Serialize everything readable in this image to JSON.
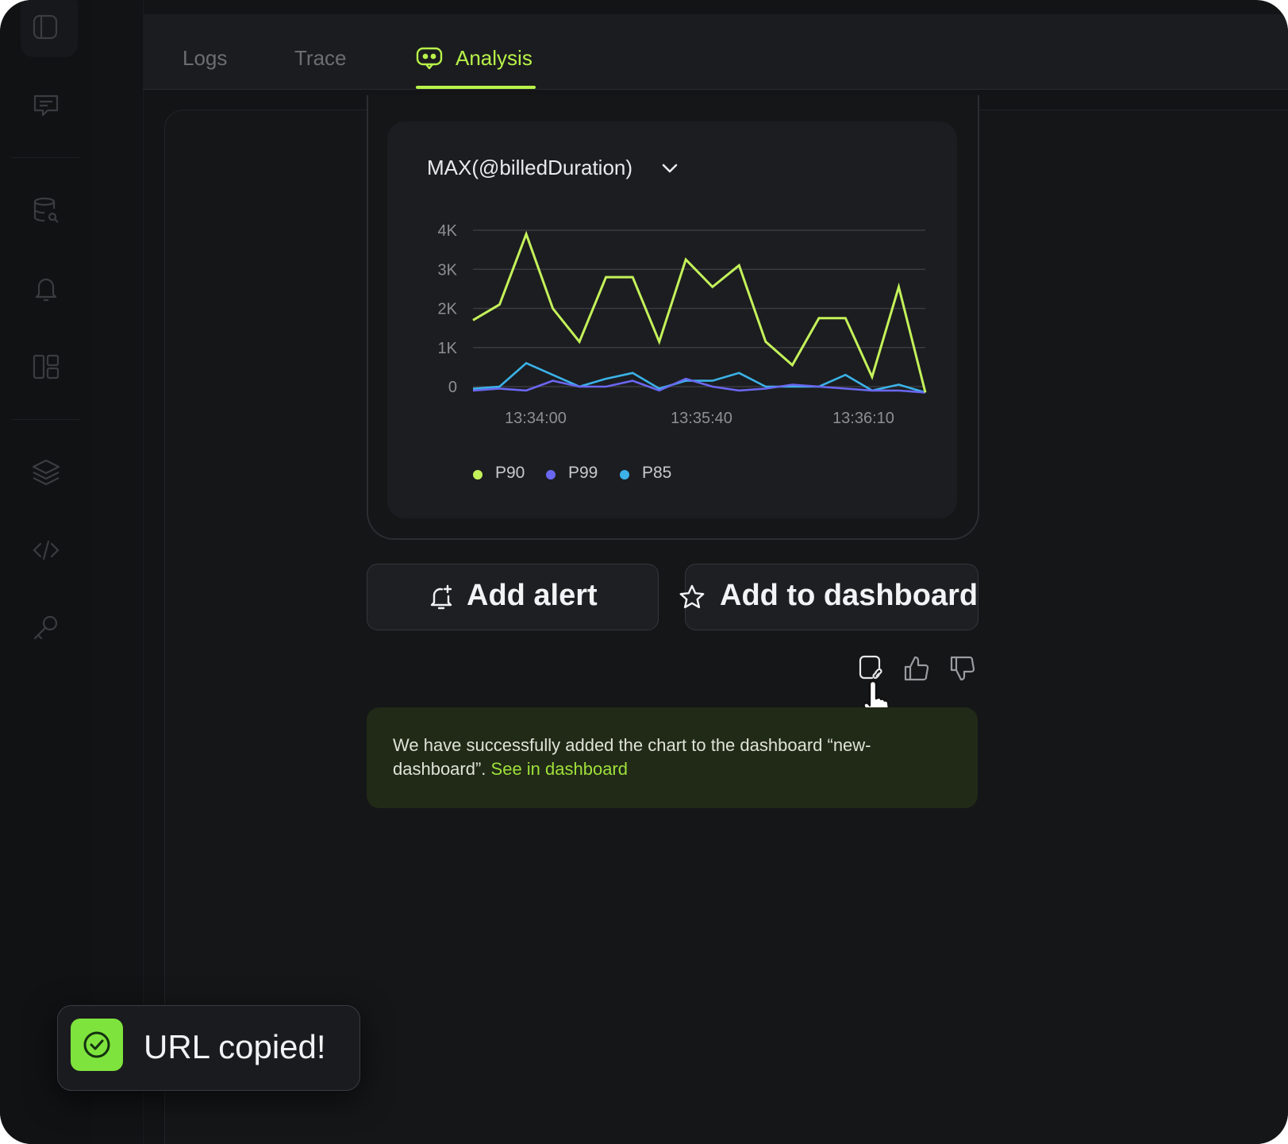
{
  "tabs": [
    {
      "label": "Logs",
      "active": false
    },
    {
      "label": "Trace",
      "active": false
    },
    {
      "label": "Analysis",
      "active": true
    }
  ],
  "chart_card": {
    "metric": "MAX(@billedDuration)"
  },
  "chart_data": {
    "type": "line",
    "x_ticks": [
      "13:34:00",
      "13:35:40",
      "13:36:10"
    ],
    "y_ticks": [
      "4K",
      "3K",
      "2K",
      "1K",
      "0"
    ],
    "ylim": [
      0,
      4000
    ],
    "grid": true,
    "legend_position": "bottom-left",
    "series": [
      {
        "name": "P90",
        "color": "#c4f25a",
        "values": [
          1700,
          2100,
          3900,
          2000,
          1150,
          2800,
          2800,
          1150,
          3250,
          2550,
          3100,
          1150,
          550,
          1750,
          1750,
          250,
          2550,
          -150
        ]
      },
      {
        "name": "P99",
        "color": "#6a67f0",
        "values": [
          -100,
          -50,
          -100,
          150,
          0,
          0,
          150,
          -100,
          200,
          0,
          -100,
          -50,
          50,
          0,
          -50,
          -100,
          -100,
          -150
        ]
      },
      {
        "name": "P85",
        "color": "#3bb2e8",
        "values": [
          -50,
          0,
          600,
          300,
          0,
          200,
          350,
          -50,
          150,
          150,
          350,
          0,
          0,
          0,
          300,
          -100,
          50,
          -150
        ]
      }
    ]
  },
  "actions": {
    "add_alert": "Add alert",
    "add_dashboard": "Add to dashboard"
  },
  "success": {
    "message": "We have successfully added the chart to the dashboard “new-dashboard”. ",
    "link": "See in dashboard"
  },
  "toast": {
    "text": "URL copied!"
  },
  "colors": {
    "accent": "#b8f24a",
    "background": "#131416",
    "success_bg": "#212a17",
    "toast_badge": "#7ee33d"
  },
  "icons": [
    "notebook-icon",
    "chat-icon",
    "database-search-icon",
    "bell-icon",
    "layout-icon",
    "layers-icon",
    "code-icon",
    "key-icon",
    "analysis-bot-icon",
    "chevron-down-icon",
    "bell-plus-icon",
    "star-icon",
    "copy-link-icon",
    "thumbs-up-icon",
    "thumbs-down-icon",
    "check-circle-icon",
    "hand-cursor-icon"
  ]
}
